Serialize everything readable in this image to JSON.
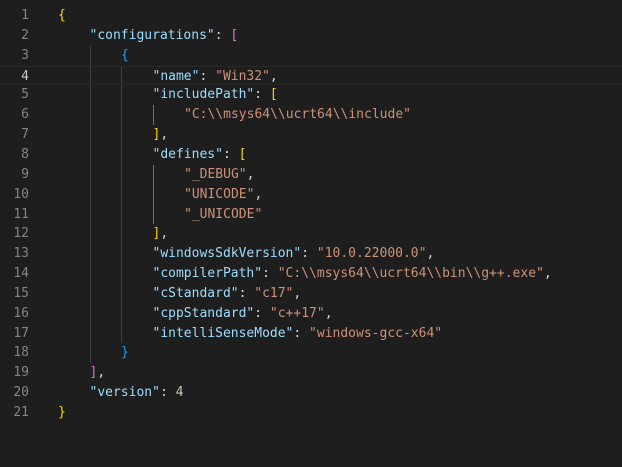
{
  "editor": {
    "language": "json",
    "active_line": 4,
    "colors": {
      "background": "#1e1e1e",
      "line_number": "#858585",
      "line_number_active": "#c6c6c6",
      "key": "#9cdcfe",
      "string": "#ce9178",
      "number": "#b5cea8",
      "punctuation": "#d4d4d4",
      "bracket_level_1": "#ffd700",
      "bracket_level_2": "#da70d6",
      "bracket_level_3": "#179fff"
    },
    "lines": [
      {
        "n": 1,
        "indent": 0,
        "tokens": [
          {
            "t": "{",
            "c": "b1"
          }
        ]
      },
      {
        "n": 2,
        "indent": 1,
        "tokens": [
          {
            "t": "\"configurations\"",
            "c": "t-key"
          },
          {
            "t": ": ",
            "c": "t-punc"
          },
          {
            "t": "[",
            "c": "b2"
          }
        ]
      },
      {
        "n": 3,
        "indent": 2,
        "tokens": [
          {
            "t": "{",
            "c": "b3"
          }
        ]
      },
      {
        "n": 4,
        "indent": 3,
        "tokens": [
          {
            "t": "\"name\"",
            "c": "t-key"
          },
          {
            "t": ": ",
            "c": "t-punc"
          },
          {
            "t": "\"Win32\"",
            "c": "t-str"
          },
          {
            "t": ",",
            "c": "t-punc"
          }
        ]
      },
      {
        "n": 5,
        "indent": 3,
        "tokens": [
          {
            "t": "\"includePath\"",
            "c": "t-key"
          },
          {
            "t": ": ",
            "c": "t-punc"
          },
          {
            "t": "[",
            "c": "b1"
          }
        ]
      },
      {
        "n": 6,
        "indent": 4,
        "tokens": [
          {
            "t": "\"C:\\\\msys64\\\\ucrt64\\\\include\"",
            "c": "t-str"
          }
        ]
      },
      {
        "n": 7,
        "indent": 3,
        "tokens": [
          {
            "t": "]",
            "c": "b1"
          },
          {
            "t": ",",
            "c": "t-punc"
          }
        ]
      },
      {
        "n": 8,
        "indent": 3,
        "tokens": [
          {
            "t": "\"defines\"",
            "c": "t-key"
          },
          {
            "t": ": ",
            "c": "t-punc"
          },
          {
            "t": "[",
            "c": "b1"
          }
        ]
      },
      {
        "n": 9,
        "indent": 4,
        "tokens": [
          {
            "t": "\"_DEBUG\"",
            "c": "t-str"
          },
          {
            "t": ",",
            "c": "t-punc"
          }
        ]
      },
      {
        "n": 10,
        "indent": 4,
        "tokens": [
          {
            "t": "\"UNICODE\"",
            "c": "t-str"
          },
          {
            "t": ",",
            "c": "t-punc"
          }
        ]
      },
      {
        "n": 11,
        "indent": 4,
        "tokens": [
          {
            "t": "\"_UNICODE\"",
            "c": "t-str"
          }
        ]
      },
      {
        "n": 12,
        "indent": 3,
        "tokens": [
          {
            "t": "]",
            "c": "b1"
          },
          {
            "t": ",",
            "c": "t-punc"
          }
        ]
      },
      {
        "n": 13,
        "indent": 3,
        "tokens": [
          {
            "t": "\"windowsSdkVersion\"",
            "c": "t-key"
          },
          {
            "t": ": ",
            "c": "t-punc"
          },
          {
            "t": "\"10.0.22000.0\"",
            "c": "t-str"
          },
          {
            "t": ",",
            "c": "t-punc"
          }
        ]
      },
      {
        "n": 14,
        "indent": 3,
        "tokens": [
          {
            "t": "\"compilerPath\"",
            "c": "t-key"
          },
          {
            "t": ": ",
            "c": "t-punc"
          },
          {
            "t": "\"C:\\\\msys64\\\\ucrt64\\\\bin\\\\g++.exe\"",
            "c": "t-str"
          },
          {
            "t": ",",
            "c": "t-punc"
          }
        ]
      },
      {
        "n": 15,
        "indent": 3,
        "tokens": [
          {
            "t": "\"cStandard\"",
            "c": "t-key"
          },
          {
            "t": ": ",
            "c": "t-punc"
          },
          {
            "t": "\"c17\"",
            "c": "t-str"
          },
          {
            "t": ",",
            "c": "t-punc"
          }
        ]
      },
      {
        "n": 16,
        "indent": 3,
        "tokens": [
          {
            "t": "\"cppStandard\"",
            "c": "t-key"
          },
          {
            "t": ": ",
            "c": "t-punc"
          },
          {
            "t": "\"c++17\"",
            "c": "t-str"
          },
          {
            "t": ",",
            "c": "t-punc"
          }
        ]
      },
      {
        "n": 17,
        "indent": 3,
        "tokens": [
          {
            "t": "\"intelliSenseMode\"",
            "c": "t-key"
          },
          {
            "t": ": ",
            "c": "t-punc"
          },
          {
            "t": "\"windows-gcc-x64\"",
            "c": "t-str"
          }
        ]
      },
      {
        "n": 18,
        "indent": 2,
        "tokens": [
          {
            "t": "}",
            "c": "b3"
          }
        ]
      },
      {
        "n": 19,
        "indent": 1,
        "tokens": [
          {
            "t": "]",
            "c": "b2"
          },
          {
            "t": ",",
            "c": "t-punc"
          }
        ]
      },
      {
        "n": 20,
        "indent": 1,
        "tokens": [
          {
            "t": "\"version\"",
            "c": "t-key"
          },
          {
            "t": ": ",
            "c": "t-punc"
          },
          {
            "t": "4",
            "c": "t-num"
          }
        ]
      },
      {
        "n": 21,
        "indent": 0,
        "tokens": [
          {
            "t": "}",
            "c": "b1"
          }
        ]
      }
    ]
  }
}
